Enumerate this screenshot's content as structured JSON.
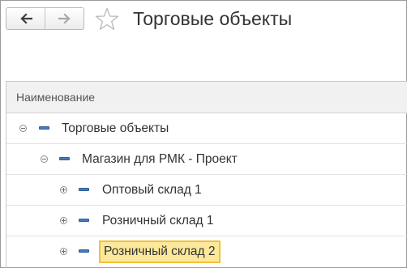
{
  "header": {
    "back_icon": "arrow-left-icon",
    "forward_icon": "arrow-right-icon",
    "favorite_icon": "star-outline-icon",
    "title": "Торговые объекты"
  },
  "list": {
    "column_header": "Наименование",
    "rows": [
      {
        "label": "Торговые объекты",
        "level": 0,
        "expander": "collapse",
        "selected": false
      },
      {
        "label": "Магазин для РМК - Проект",
        "level": 1,
        "expander": "collapse",
        "selected": false
      },
      {
        "label": "Оптовый склад 1",
        "level": 2,
        "expander": "expand",
        "selected": false
      },
      {
        "label": "Розничный склад 1",
        "level": 2,
        "expander": "expand",
        "selected": false
      },
      {
        "label": "Розничный склад 2",
        "level": 2,
        "expander": "expand",
        "selected": true
      }
    ]
  },
  "colors": {
    "item_icon": "#4b7ab8",
    "selection_fill": "#fce89a",
    "selection_border": "#f0c23b"
  }
}
